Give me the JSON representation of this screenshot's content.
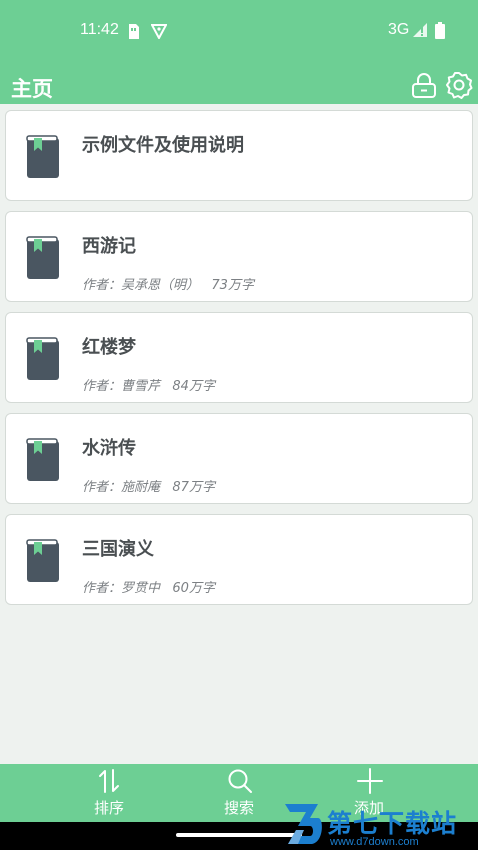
{
  "status_bar": {
    "time": "11:42",
    "network": "3G"
  },
  "appbar": {
    "title": "主页"
  },
  "books": [
    {
      "title": "示例文件及使用说明",
      "meta": ""
    },
    {
      "title": "西游记",
      "meta": "作者：吴承恩（明）   73万字"
    },
    {
      "title": "红楼梦",
      "meta": "作者：曹雪芹   84万字"
    },
    {
      "title": "水浒传",
      "meta": "作者：施耐庵   87万字"
    },
    {
      "title": "三国演义",
      "meta": "作者：罗贯中   60万字"
    }
  ],
  "bottom_nav": {
    "sort_label": "排序",
    "search_label": "搜索",
    "add_label": "添加"
  },
  "watermark": {
    "title": "第七下载站",
    "url": "www.d7down.com"
  },
  "colors": {
    "accent": "#6dcf94",
    "book_cover": "#4a5661",
    "bookmark": "#6dcf94",
    "card_bg": "#ffffff",
    "page_bg": "#eef2ef"
  },
  "icons": {
    "appbar": [
      "lock-icon",
      "gear-icon"
    ],
    "nav": [
      "sort-icon",
      "search-icon",
      "plus-icon"
    ],
    "book": "book-icon"
  }
}
